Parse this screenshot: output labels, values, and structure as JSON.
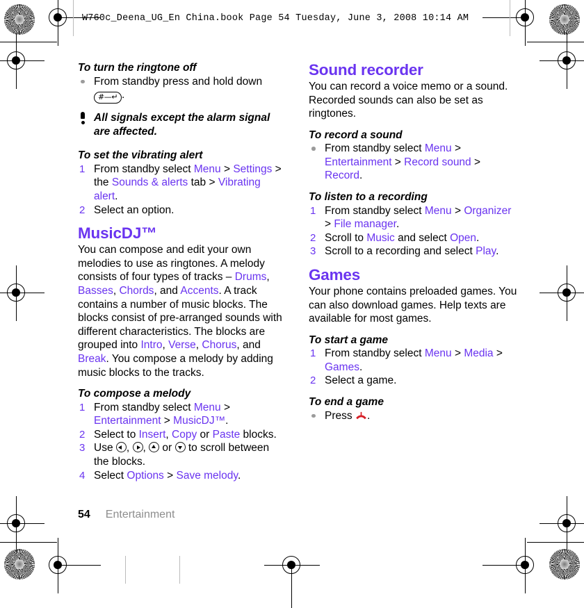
{
  "document": {
    "running_head": "W760c_Deena_UG_En China.book  Page 54  Tuesday, June 3, 2008  10:14 AM",
    "accent_color": "#6a34f0",
    "bullet_color": "#9b9b9b",
    "endcall_color": "#d61f26",
    "footer": {
      "page_number": "54",
      "chapter": "Entertainment"
    }
  },
  "left_column": {
    "proc_ringtone_off": {
      "title": "To turn the ringtone off",
      "bullet_text_before": "From standby press and hold down",
      "key_glyph": "#—↵",
      "bullet_text_after": "."
    },
    "note": {
      "text": "All signals except the alarm signal are affected.",
      "icon": "exclamation-icon"
    },
    "proc_vibrating_alert": {
      "title": "To set the vibrating alert",
      "steps": [
        {
          "number": "1",
          "segments": [
            {
              "t": "From standby select ",
              "link": false
            },
            {
              "t": "Menu",
              "link": true
            },
            {
              "t": " > ",
              "link": false
            },
            {
              "t": "Settings",
              "link": true
            },
            {
              "t": " > the ",
              "link": false
            },
            {
              "t": "Sounds & alerts",
              "link": true
            },
            {
              "t": " tab > ",
              "link": false
            },
            {
              "t": "Vibrating alert",
              "link": true
            },
            {
              "t": ".",
              "link": false
            }
          ]
        },
        {
          "number": "2",
          "segments": [
            {
              "t": "Select an option.",
              "link": false
            }
          ]
        }
      ]
    },
    "musicdj": {
      "title": "MusicDJ™",
      "intro_segments": [
        {
          "t": "You can compose and edit your own melodies to use as ringtones. A melody consists of four types of tracks – ",
          "link": false
        },
        {
          "t": "Drums",
          "link": true
        },
        {
          "t": ", ",
          "link": false
        },
        {
          "t": "Basses",
          "link": true
        },
        {
          "t": ", ",
          "link": false
        },
        {
          "t": "Chords",
          "link": true
        },
        {
          "t": ", and ",
          "link": false
        },
        {
          "t": "Accents",
          "link": true
        },
        {
          "t": ". A track contains a number of music blocks. The blocks consist of pre-arranged sounds with different characteristics. The blocks are grouped into ",
          "link": false
        },
        {
          "t": "Intro",
          "link": true
        },
        {
          "t": ", ",
          "link": false
        },
        {
          "t": "Verse",
          "link": true
        },
        {
          "t": ", ",
          "link": false
        },
        {
          "t": "Chorus",
          "link": true
        },
        {
          "t": ", and ",
          "link": false
        },
        {
          "t": "Break",
          "link": true
        },
        {
          "t": ". You compose a melody by adding music blocks to the tracks.",
          "link": false
        }
      ]
    },
    "proc_compose_melody": {
      "title": "To compose a melody",
      "steps": [
        {
          "number": "1",
          "segments": [
            {
              "t": "From standby select ",
              "link": false
            },
            {
              "t": "Menu",
              "link": true
            },
            {
              "t": " > ",
              "link": false
            },
            {
              "t": "Entertainment",
              "link": true
            },
            {
              "t": " > ",
              "link": false
            },
            {
              "t": "MusicDJ™",
              "link": true
            },
            {
              "t": ".",
              "link": false
            }
          ]
        },
        {
          "number": "2",
          "segments": [
            {
              "t": "Select to ",
              "link": false
            },
            {
              "t": "Insert",
              "link": true
            },
            {
              "t": ", ",
              "link": false
            },
            {
              "t": "Copy",
              "link": true
            },
            {
              "t": " or ",
              "link": false
            },
            {
              "t": "Paste",
              "link": true
            },
            {
              "t": " blocks.",
              "link": false
            }
          ]
        },
        {
          "number": "3",
          "text_before_keys": "Use ",
          "keys": [
            "nav-left-key",
            "nav-right-key",
            "nav-up-key",
            "nav-down-key"
          ],
          "text_after_keys": " to scroll between the blocks."
        },
        {
          "number": "4",
          "segments": [
            {
              "t": "Select ",
              "link": false
            },
            {
              "t": "Options",
              "link": true
            },
            {
              "t": " > ",
              "link": false
            },
            {
              "t": "Save melody",
              "link": true
            },
            {
              "t": ".",
              "link": false
            }
          ]
        }
      ]
    }
  },
  "right_column": {
    "sound_recorder": {
      "title": "Sound recorder",
      "intro": "You can record a voice memo or a sound. Recorded sounds can also be set as ringtones."
    },
    "proc_record_sound": {
      "title": "To record a sound",
      "bullet_segments": [
        {
          "t": "From standby select ",
          "link": false
        },
        {
          "t": "Menu",
          "link": true
        },
        {
          "t": " > ",
          "link": false
        },
        {
          "t": "Entertainment",
          "link": true
        },
        {
          "t": " > ",
          "link": false
        },
        {
          "t": "Record sound",
          "link": true
        },
        {
          "t": " > ",
          "link": false
        },
        {
          "t": "Record",
          "link": true
        },
        {
          "t": ".",
          "link": false
        }
      ]
    },
    "proc_listen_recording": {
      "title": "To listen to a recording",
      "steps": [
        {
          "number": "1",
          "segments": [
            {
              "t": "From standby select ",
              "link": false
            },
            {
              "t": "Menu",
              "link": true
            },
            {
              "t": " > ",
              "link": false
            },
            {
              "t": "Organizer",
              "link": true
            },
            {
              "t": " > ",
              "link": false
            },
            {
              "t": "File manager",
              "link": true
            },
            {
              "t": ".",
              "link": false
            }
          ]
        },
        {
          "number": "2",
          "segments": [
            {
              "t": "Scroll to ",
              "link": false
            },
            {
              "t": "Music",
              "link": true
            },
            {
              "t": " and select ",
              "link": false
            },
            {
              "t": "Open",
              "link": true
            },
            {
              "t": ".",
              "link": false
            }
          ]
        },
        {
          "number": "3",
          "segments": [
            {
              "t": "Scroll to a recording and select ",
              "link": false
            },
            {
              "t": "Play",
              "link": true
            },
            {
              "t": ".",
              "link": false
            }
          ]
        }
      ]
    },
    "games": {
      "title": "Games",
      "intro": "Your phone contains preloaded games. You can also download games. Help texts are available for most games."
    },
    "proc_start_game": {
      "title": "To start a game",
      "steps": [
        {
          "number": "1",
          "segments": [
            {
              "t": "From standby select ",
              "link": false
            },
            {
              "t": "Menu",
              "link": true
            },
            {
              "t": " > ",
              "link": false
            },
            {
              "t": "Media",
              "link": true
            },
            {
              "t": " > ",
              "link": false
            },
            {
              "t": "Games",
              "link": true
            },
            {
              "t": ".",
              "link": false
            }
          ]
        },
        {
          "number": "2",
          "segments": [
            {
              "t": "Select a game.",
              "link": false
            }
          ]
        }
      ]
    },
    "proc_end_game": {
      "title": "To end a game",
      "bullet_text_before": "Press ",
      "key": "end-call-key",
      "bullet_text_after": "."
    }
  }
}
